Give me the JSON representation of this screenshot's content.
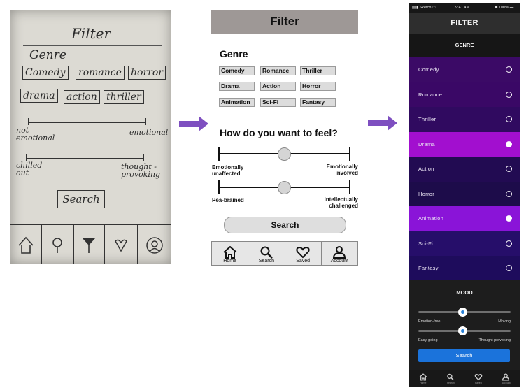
{
  "sketch": {
    "title": "Filter",
    "genre_heading": "Genre",
    "genres": [
      "Comedy",
      "romance",
      "horror",
      "drama",
      "action",
      "thriller"
    ],
    "slider1": {
      "left": "not emotional",
      "right": "emotional"
    },
    "slider2": {
      "left": "chilled out",
      "right": "thought -provoking"
    },
    "search_label": "Search",
    "tabs": [
      "home-icon",
      "pin-icon",
      "cocktail-icon",
      "heart-icon",
      "account-icon"
    ]
  },
  "wireframe": {
    "title": "Filter",
    "genre_heading": "Genre",
    "genres": [
      "Comedy",
      "Romance",
      "Thriller",
      "Drama",
      "Action",
      "Horror",
      "Animation",
      "Sci-Fi",
      "Fantasy"
    ],
    "feel_heading": "How do you want to feel?",
    "slider1": {
      "left": "Emotionally unaffected",
      "right": "Emotionally involved",
      "value": 0.5
    },
    "slider2": {
      "left": "Pea-brained",
      "right": "Intellectually challenged",
      "value": 0.5
    },
    "search_label": "Search",
    "tabs": [
      {
        "label": "Home",
        "icon": "home-icon"
      },
      {
        "label": "Search",
        "icon": "search-icon"
      },
      {
        "label": "Saved",
        "icon": "heart-icon"
      },
      {
        "label": "Account",
        "icon": "account-icon"
      }
    ]
  },
  "phone": {
    "status": {
      "carrier": "Sketch",
      "time": "9:41 AM",
      "battery": "100%"
    },
    "title": "FILTER",
    "genre_heading": "GENRE",
    "genres": [
      {
        "label": "Comedy",
        "selected": false,
        "bg": "#3b0a66"
      },
      {
        "label": "Romance",
        "selected": false,
        "bg": "#3a0866"
      },
      {
        "label": "Thriller",
        "selected": false,
        "bg": "#300a60"
      },
      {
        "label": "Drama",
        "selected": true,
        "bg": "#a20fcf"
      },
      {
        "label": "Action",
        "selected": false,
        "bg": "#220b52"
      },
      {
        "label": "Horror",
        "selected": false,
        "bg": "#1d0c4a"
      },
      {
        "label": "Animation",
        "selected": true,
        "bg": "#8a14d8"
      },
      {
        "label": "Sci-Fi",
        "selected": false,
        "bg": "#260e6a"
      },
      {
        "label": "Fantasy",
        "selected": false,
        "bg": "#1e0c5c"
      }
    ],
    "mood_heading": "MOOD",
    "slider1": {
      "left": "Emotion-free",
      "right": "Moving",
      "value": 0.48
    },
    "slider2": {
      "left": "Easy-going",
      "right": "Thought provoking",
      "value": 0.48
    },
    "search_label": "Search",
    "tabs": [
      {
        "label": "Home",
        "icon": "home-icon"
      },
      {
        "label": "Search",
        "icon": "search-icon"
      },
      {
        "label": "Saved",
        "icon": "heart-icon"
      },
      {
        "label": "Account",
        "icon": "account-icon"
      }
    ]
  },
  "colors": {
    "arrow": "#7e4fc0",
    "accent_blue": "#1b73db",
    "wireframe_header": "#9e9896"
  }
}
